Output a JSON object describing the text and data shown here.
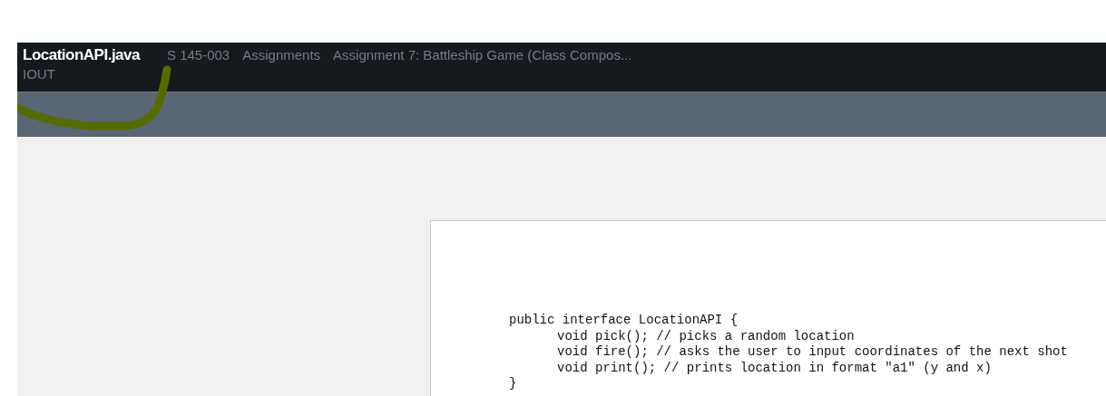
{
  "header": {
    "title": "LocationAPI.java",
    "breadcrumbs": [
      "S 145-003",
      "Assignments",
      "Assignment 7: Battleship Game (Class Compos..."
    ],
    "subtitle": "IOUT"
  },
  "document": {
    "code": {
      "opening_line": "public interface LocationAPI {",
      "body_lines": [
        "void pick(); // picks a random location",
        "void fire(); // asks the user to input coordinates of the next shot",
        "void print(); // prints location in format \"a1\" (y and x)"
      ],
      "closing_line": "}"
    }
  }
}
